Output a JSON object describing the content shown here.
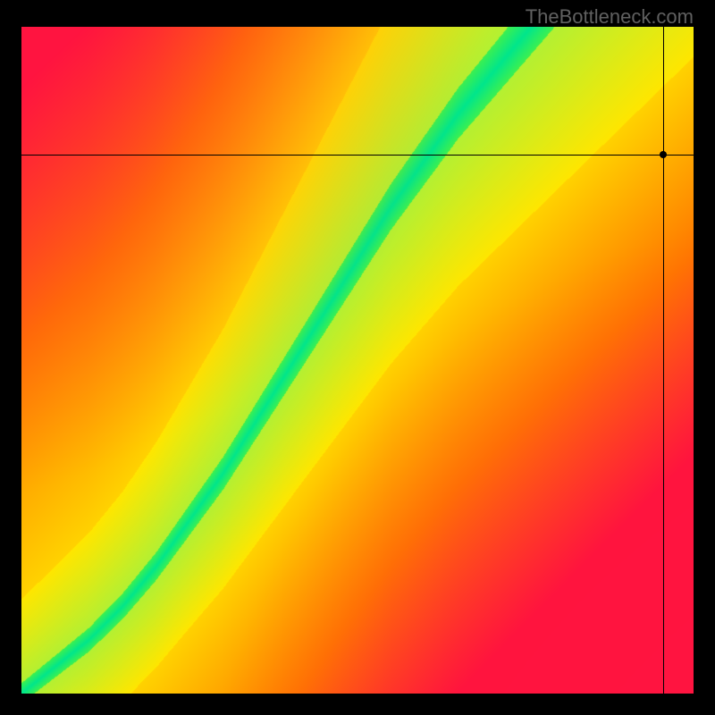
{
  "watermark": "TheBottleneck.com",
  "chart_data": {
    "type": "heatmap",
    "title": "",
    "xlabel": "",
    "ylabel": "",
    "xlim": [
      0,
      1
    ],
    "ylim": [
      0,
      1
    ],
    "grid": false,
    "marker": {
      "x": 0.955,
      "y": 0.808
    },
    "colorscale_description": "red to yellow to green; green ridge along a curved diagonal from bottom-left to upper-center",
    "ridge_curve": [
      {
        "x": 0.0,
        "y": 0.0
      },
      {
        "x": 0.05,
        "y": 0.04
      },
      {
        "x": 0.1,
        "y": 0.08
      },
      {
        "x": 0.15,
        "y": 0.13
      },
      {
        "x": 0.2,
        "y": 0.19
      },
      {
        "x": 0.25,
        "y": 0.26
      },
      {
        "x": 0.3,
        "y": 0.33
      },
      {
        "x": 0.35,
        "y": 0.41
      },
      {
        "x": 0.4,
        "y": 0.49
      },
      {
        "x": 0.45,
        "y": 0.57
      },
      {
        "x": 0.5,
        "y": 0.65
      },
      {
        "x": 0.55,
        "y": 0.73
      },
      {
        "x": 0.6,
        "y": 0.8
      },
      {
        "x": 0.65,
        "y": 0.87
      },
      {
        "x": 0.7,
        "y": 0.93
      },
      {
        "x": 0.75,
        "y": 0.99
      }
    ]
  }
}
